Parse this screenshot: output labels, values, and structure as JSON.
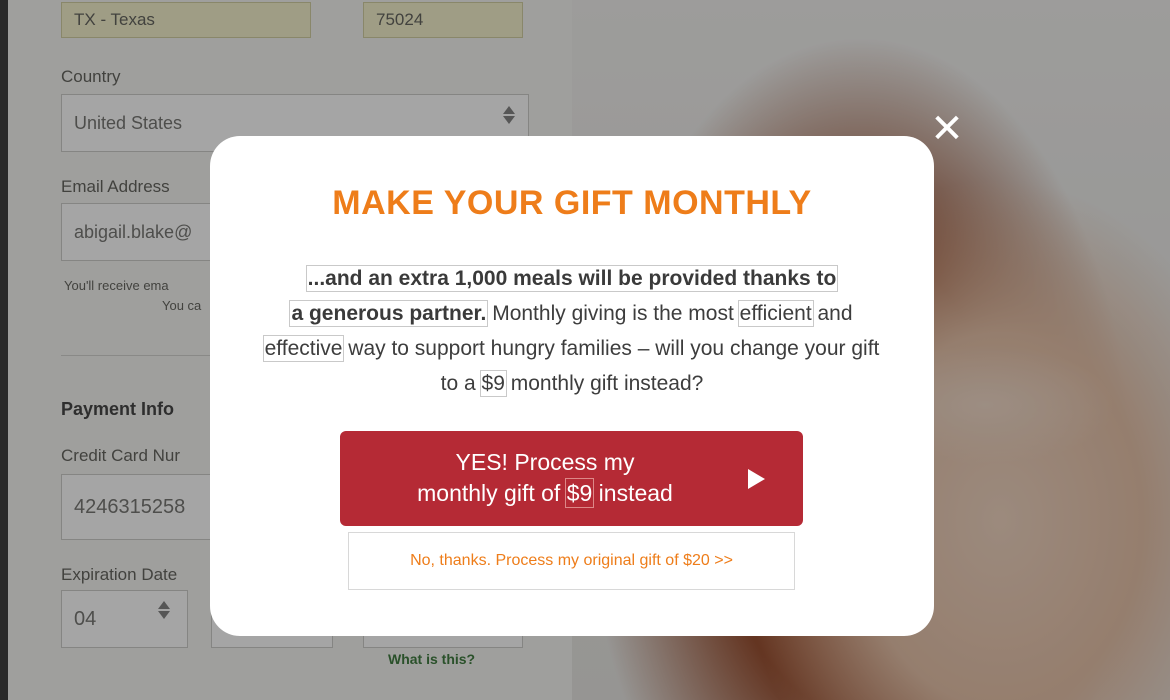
{
  "form": {
    "state_value": "TX - Texas",
    "zip_value": "75024",
    "country_label": "Country",
    "country_value": "United States",
    "email_label": "Email Address",
    "email_value": "abigail.blake@",
    "email_note_line1": "You'll receive ema",
    "email_note_line2": "You ca",
    "payment_title": "Payment Info",
    "card_label": "Credit Card Nur",
    "card_value": "4246315258",
    "expiration_label": "Expiration Date",
    "expiration_month": "04",
    "cvv_help": "What is this?"
  },
  "modal": {
    "close_symbol": "✕",
    "title": "MAKE YOUR GIFT MONTHLY",
    "body_bold_1": "...and an extra 1,000 meals will be provided thanks to",
    "body_bold_2": "a generous partner.",
    "body_text_1": " Monthly giving is the most ",
    "body_word_efficient": "efficient",
    "body_text_2": " and ",
    "body_word_effective": "effective",
    "body_text_3": " way to support hungry families – will you change your gift to a ",
    "body_amount": "$9",
    "body_text_4": " monthly gift instead?",
    "yes_line1": "YES! Process my",
    "yes_line2_prefix": "monthly gift of ",
    "yes_amount": "$9",
    "yes_line2_suffix": " instead",
    "no_label": "No, thanks. Process my original gift of $20 >>"
  },
  "colors": {
    "accent_orange": "#ee7d1a",
    "primary_red": "#b52a35"
  }
}
